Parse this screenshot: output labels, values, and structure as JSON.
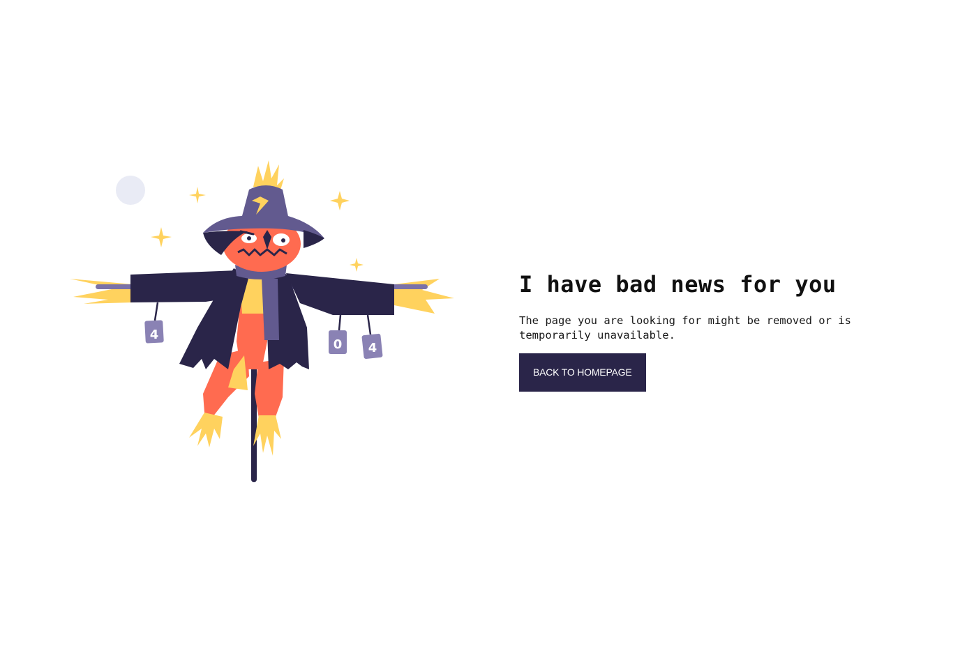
{
  "error": {
    "title": "I have bad news for you",
    "message": "The page you are looking for might be removed or is temporarily unavailable.",
    "button_label": "BACK TO HOMEPAGE"
  },
  "illustration": {
    "can_labels": [
      "4",
      "0",
      "4"
    ],
    "colors": {
      "navy": "#2a2549",
      "purple": "#625a8f",
      "can": "#8a82b4",
      "orange": "#ff6b50",
      "yellow": "#ffd25e",
      "moon": "#e9ebf5"
    }
  },
  "colors": {
    "button_bg": "#2a2549",
    "button_text": "#ffffff",
    "text": "#111111"
  }
}
